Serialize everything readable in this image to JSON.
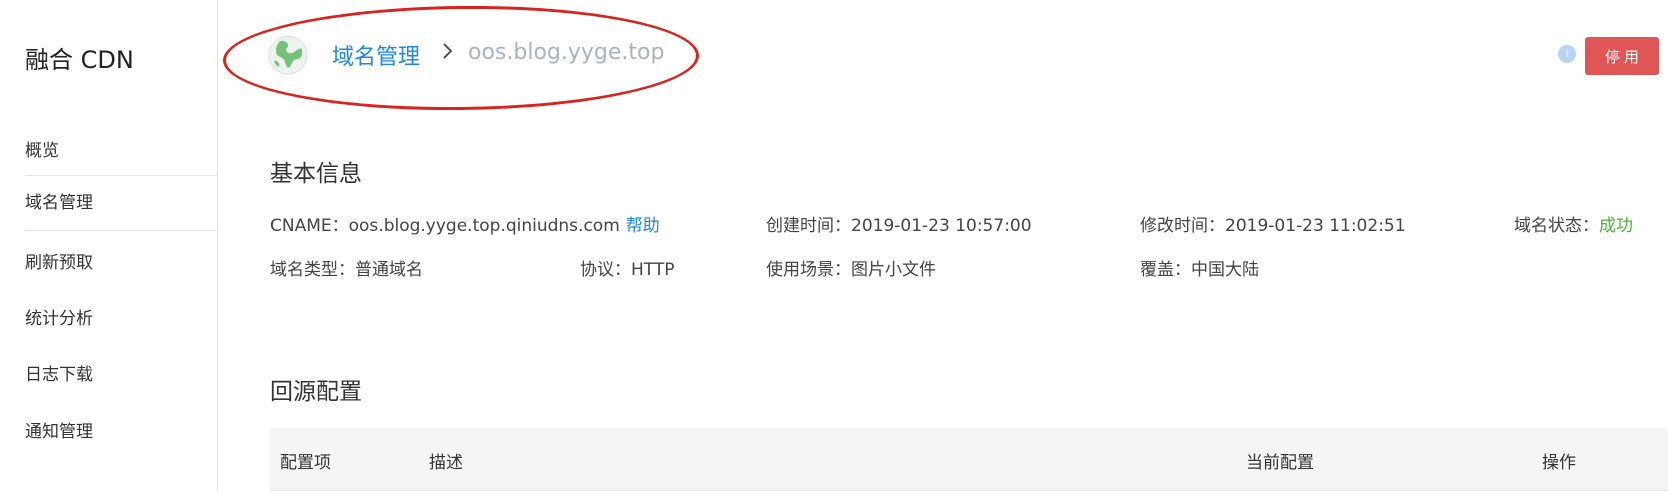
{
  "sidebar": {
    "title": "融合 CDN",
    "items": [
      {
        "label": "概览"
      },
      {
        "label": "域名管理"
      },
      {
        "label": "刷新预取"
      },
      {
        "label": "统计分析"
      },
      {
        "label": "日志下载"
      },
      {
        "label": "通知管理"
      }
    ]
  },
  "breadcrumb": {
    "parent": "域名管理",
    "current": "oos.blog.yyge.top"
  },
  "header": {
    "info_icon": "i",
    "disable_button": "停用"
  },
  "basic_info": {
    "title": "基本信息",
    "cname_label": "CNAME：",
    "cname_value": "oos.blog.yyge.top.qiniudns.com",
    "help": "帮助",
    "created_label": "创建时间：",
    "created_value": "2019-01-23 10:57:00",
    "modified_label": "修改时间：",
    "modified_value": "2019-01-23 11:02:51",
    "status_label": "域名状态：",
    "status_value": "成功",
    "type_label": "域名类型：",
    "type_value": "普通域名",
    "protocol_label": "协议：",
    "protocol_value": "HTTP",
    "scenario_label": "使用场景：",
    "scenario_value": "图片小文件",
    "coverage_label": "覆盖：",
    "coverage_value": "中国大陆"
  },
  "origin": {
    "title": "回源配置",
    "columns": [
      "配置项",
      "描述",
      "当前配置",
      "操作"
    ]
  },
  "colors": {
    "link": "#1e88e5",
    "danger": "#e05656",
    "success": "#45b835",
    "annotation": "#d8231e"
  }
}
